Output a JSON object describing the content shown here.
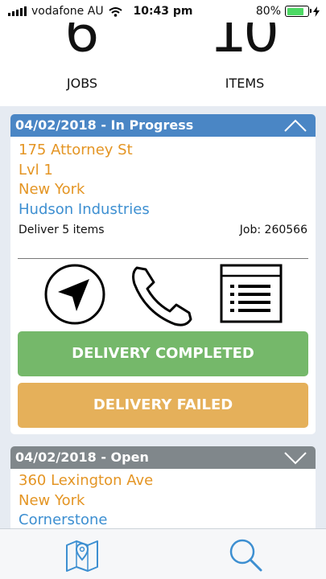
{
  "status_bar": {
    "carrier": "vodafone AU",
    "time": "10:43 pm",
    "battery": "80%",
    "battery_level": 0.8
  },
  "summary": {
    "jobs_count": "6",
    "jobs_label": "JOBS",
    "items_count": "10",
    "items_label": "ITEMS"
  },
  "jobs": [
    {
      "header": "04/02/2018 - In Progress",
      "address_lines": [
        "175 Attorney St",
        "Lvl 1",
        "New York"
      ],
      "company": "Hudson Industries",
      "deliver": "Deliver 5 items",
      "job": "Job: 260566",
      "complete_label": "DELIVERY COMPLETED",
      "failed_label": "DELIVERY FAILED",
      "header_color": "#4a86c5"
    },
    {
      "header": "04/02/2018 - Open",
      "address_lines": [
        "360 Lexington Ave",
        "New York"
      ],
      "company": "Cornerstone",
      "header_color": "#80878b"
    }
  ],
  "colors": {
    "address": "#e49524",
    "company": "#3d8fd1",
    "complete": "#75b86a",
    "failed": "#e5b05a",
    "tab_icon": "#3d8fd1"
  },
  "icons": {
    "navigate": "navigation-arrow-icon",
    "call": "phone-icon",
    "details": "list-icon",
    "map_tab": "map-pin-icon",
    "search_tab": "search-icon"
  }
}
